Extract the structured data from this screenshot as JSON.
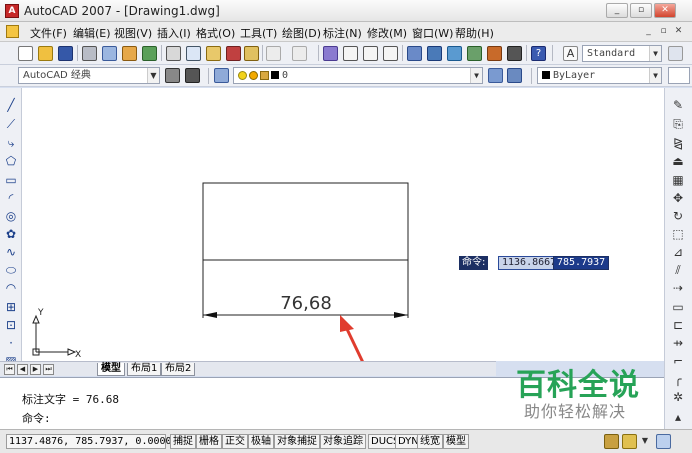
{
  "window": {
    "title": "AutoCAD 2007 - [Drawing1.dwg]",
    "controls": {
      "minimize": "_",
      "restore": "▫",
      "close": "✕"
    }
  },
  "menubar": {
    "items": [
      "文件(F)",
      "编辑(E)",
      "视图(V)",
      "插入(I)",
      "格式(O)",
      "工具(T)",
      "绘图(D)",
      "标注(N)",
      "修改(M)",
      "窗口(W)",
      "帮助(H)"
    ],
    "mdi_controls": [
      "_",
      "▫",
      "✕"
    ]
  },
  "toolbars": {
    "text_style": "Standard",
    "workspace": "AutoCAD 经典",
    "layer_name": "0",
    "color": "ByLayer",
    "colors": {
      "layer_bulb": "#f2d21b",
      "layer_sun": "#f2a900",
      "layer_swatch": "#000000"
    }
  },
  "drawing": {
    "dimension_text": "76,68",
    "ucs_y_label": "Y",
    "ucs_x_label": "X",
    "annotation_color": "#e03c2e"
  },
  "layout_tabs": [
    "模型",
    "布局1",
    "布局2"
  ],
  "dynamic_input": {
    "prompt": "命令:",
    "x_value": "1136.8667",
    "y_value": "785.7937"
  },
  "command": {
    "history": "标注文字 = 76.68",
    "prompt": "命令:"
  },
  "statusbar": {
    "coordinates": "1137.4876, 785.7937, 0.0000",
    "toggles": [
      "捕捉",
      "栅格",
      "正交",
      "极轴",
      "对象捕捉",
      "对象追踪",
      "DUCS",
      "DYN",
      "线宽",
      "模型"
    ]
  },
  "watermark": {
    "main": "百科全说",
    "sub": "助你轻松解决"
  }
}
